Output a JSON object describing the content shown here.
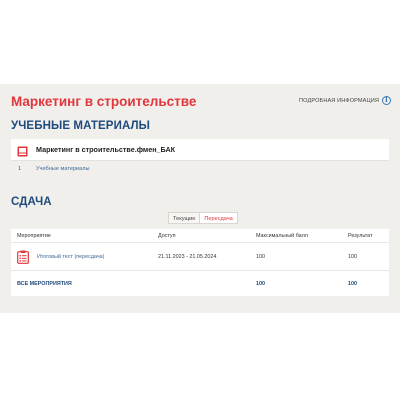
{
  "course": {
    "title": "Маркетинг в строительстве",
    "details_label": "ПОДРОБНАЯ ИНФОРМАЦИЯ",
    "details_icon": "info-icon"
  },
  "materials": {
    "heading": "УЧЕБНЫЕ МАТЕРИАЛЫ",
    "card_title": "Маркетинг в строительстве.фмен_БАК",
    "card_icon": "book-icon",
    "rows": [
      {
        "num": "1",
        "label": "Учебные материалы"
      }
    ]
  },
  "exam": {
    "heading": "СДАЧА",
    "tabs": [
      {
        "label": "Текущие",
        "active": false
      },
      {
        "label": "Пересдача",
        "active": true
      }
    ],
    "columns": [
      "Мероприятие",
      "Доступ",
      "Максимальный балл",
      "Результат"
    ],
    "rows": [
      {
        "icon": "clipboard-icon",
        "event": "Итоговый тест (пересдача)",
        "access": "21.11.2023 - 21.05.2024",
        "max_score": "100",
        "result": "100"
      }
    ],
    "total": {
      "label": "ВСЕ МЕРОПРИЯТИЯ",
      "max_score": "100",
      "result": "100"
    }
  },
  "colors": {
    "accent": "#e0363c",
    "heading": "#1e4a7c",
    "link": "#3d6a96",
    "panel_bg": "#f0efec"
  }
}
